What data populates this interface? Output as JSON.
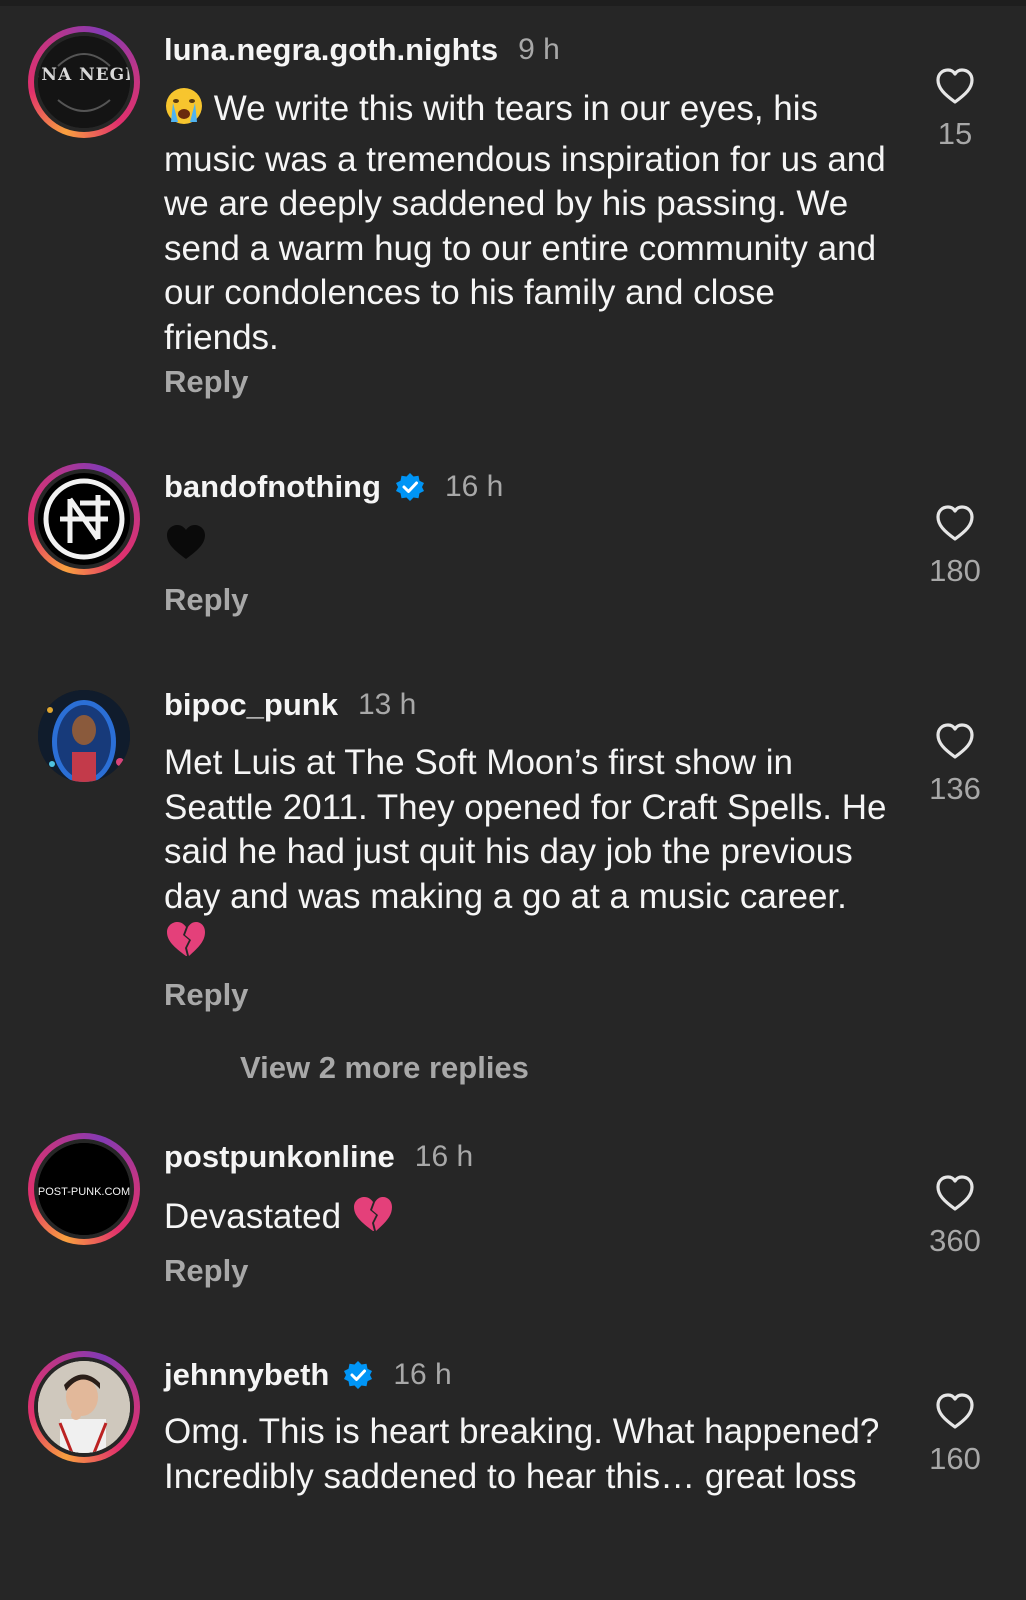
{
  "comments": [
    {
      "username": "luna.negra.goth.nights",
      "time": "9 h",
      "avatar_text": "LUNA NEGRA",
      "verified": false,
      "text_lead": "We write this with tears in our eyes, his music was a tremendous inspiration for us and we are deeply saddened by his passing. We send a warm hug to our entire community and our condolences to his family and close friends.",
      "lead_emoji": "loudly-crying-face-emoji",
      "reply_label": "Reply",
      "likes": "15"
    },
    {
      "username": "bandofnothing",
      "time": "16 h",
      "verified": true,
      "text_emoji": "black-heart-emoji",
      "reply_label": "Reply",
      "likes": "180"
    },
    {
      "username": "bipoc_punk",
      "time": "13 h",
      "verified": false,
      "text": "Met Luis at The Soft Moon’s first show in Seattle 2011. They opened for Craft Spells. He said he had just quit his day job the previous day and was making a go at a music career.",
      "trail_emoji": "broken-heart-emoji",
      "reply_label": "Reply",
      "likes": "136",
      "view_more": "View 2 more replies"
    },
    {
      "username": "postpunkonline",
      "time": "16 h",
      "verified": false,
      "avatar_text": "POST-PUNK.COM",
      "text": "Devastated",
      "trail_emoji": "broken-heart-emoji",
      "reply_label": "Reply",
      "likes": "360"
    },
    {
      "username": "jehnnybeth",
      "time": "16 h",
      "verified": true,
      "text": "Omg. This is heart breaking. What happened? Incredibly saddened to hear this… great loss",
      "likes": "160"
    }
  ],
  "colors": {
    "background": "#262626",
    "text": "#f5f5f5",
    "secondary": "#a8a8a8",
    "verified_blue": "#0095f6",
    "broken_heart": "#e4407a"
  }
}
